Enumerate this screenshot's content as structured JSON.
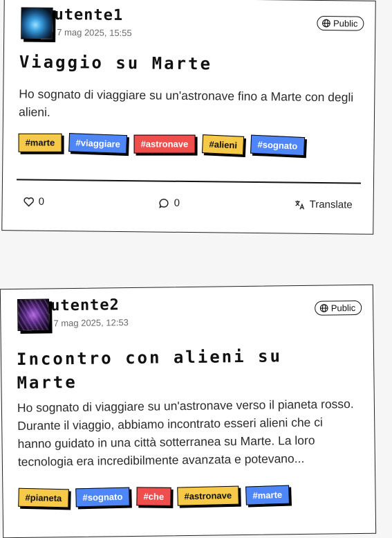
{
  "posts": [
    {
      "username": "utente1",
      "date": "7 mag 2025, 15:55",
      "visibility": "Public",
      "title": "Viaggio su Marte",
      "body": "Ho sognato di viaggiare su un'astronave fino a Marte con degli alieni.",
      "tags": [
        {
          "label": "#marte",
          "color": "yellow"
        },
        {
          "label": "#viaggiare",
          "color": "blue"
        },
        {
          "label": "#astronave",
          "color": "red"
        },
        {
          "label": "#alieni",
          "color": "yellow"
        },
        {
          "label": "#sognato",
          "color": "blue"
        }
      ],
      "likes": "0",
      "comments": "0",
      "translate_label": "Translate"
    },
    {
      "username": "utente2",
      "date": "7 mag 2025, 12:53",
      "visibility": "Public",
      "title": "Incontro con alieni su Marte",
      "body": "Ho sognato di viaggiare su un'astronave verso il pianeta rosso. Durante il viaggio, abbiamo incontrato esseri alieni che ci hanno guidato in una città sotterranea su Marte. La loro tecnologia era incredibilmente avanzata e potevano...",
      "tags": [
        {
          "label": "#pianeta",
          "color": "yellow"
        },
        {
          "label": "#sognato",
          "color": "blue"
        },
        {
          "label": "#che",
          "color": "red"
        },
        {
          "label": "#astronave",
          "color": "yellow"
        },
        {
          "label": "#marte",
          "color": "blue"
        }
      ]
    }
  ],
  "colors": {
    "yellow": "#f7c948",
    "blue": "#4f86f7",
    "red": "#f04d4d"
  },
  "icons": {
    "visibility": "globe-icon",
    "like": "heart-icon",
    "comment": "comment-bubble-icon",
    "translate": "translate-icon"
  }
}
